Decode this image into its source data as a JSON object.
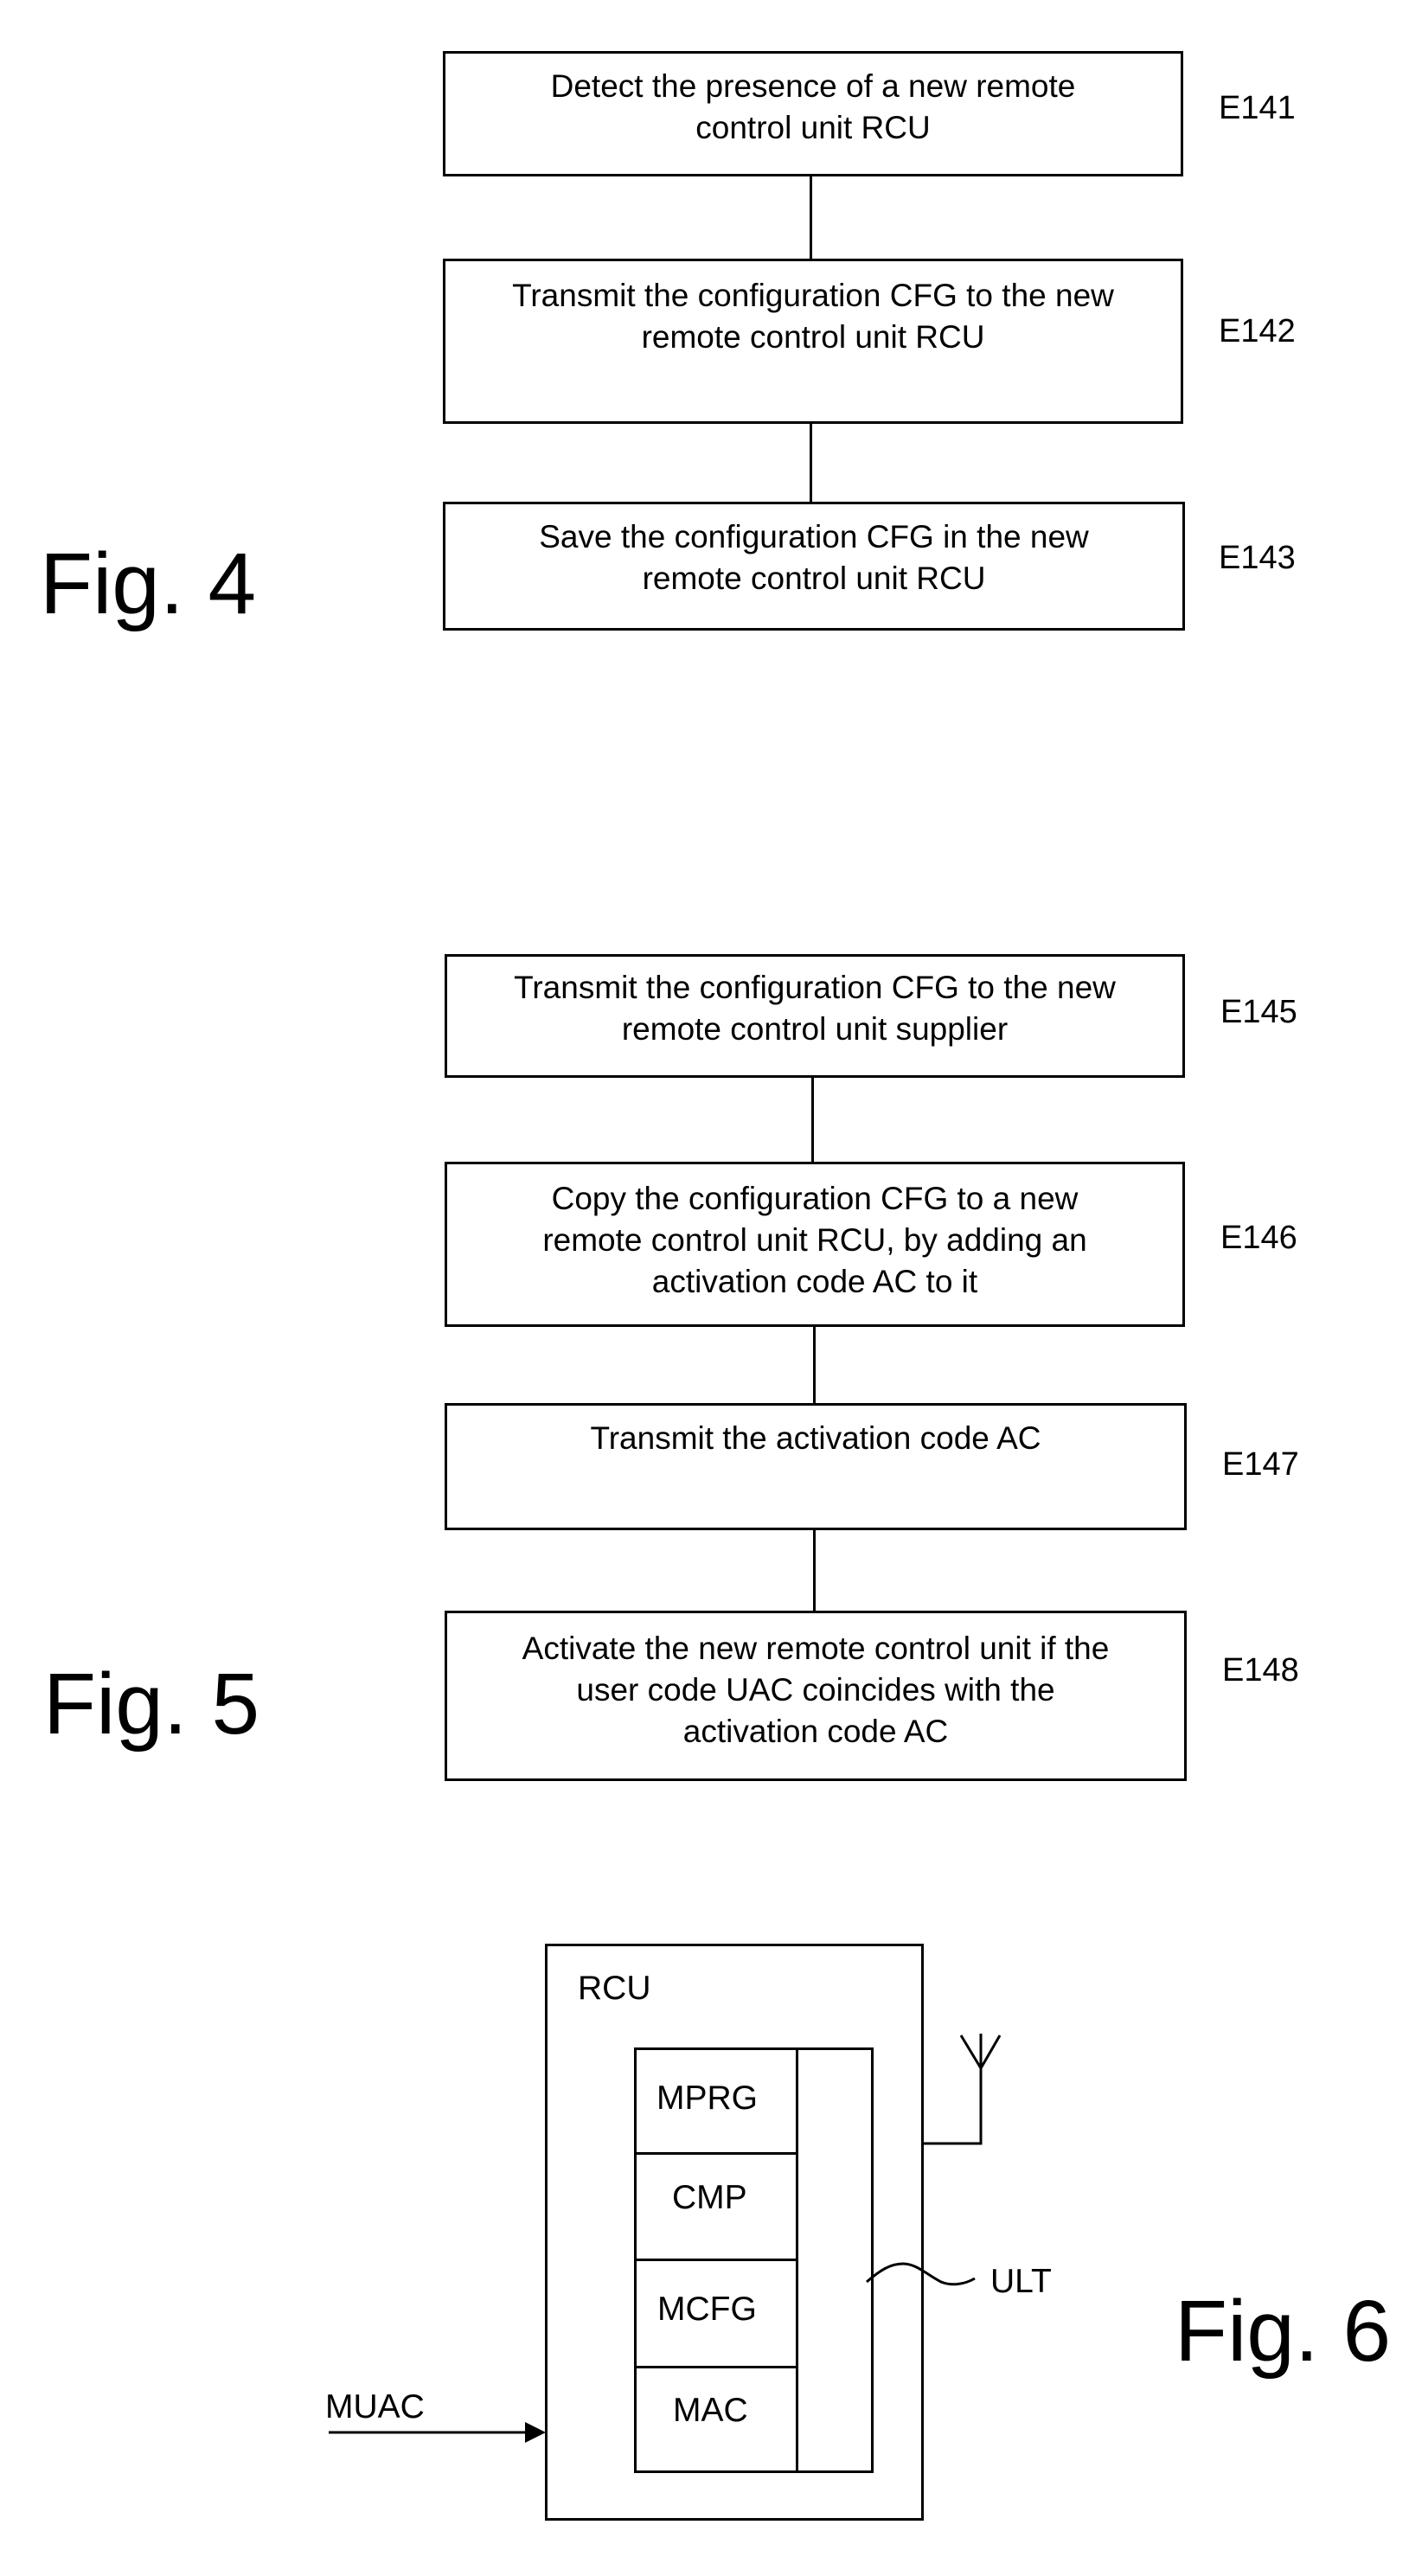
{
  "colors": {
    "ink": "#000000",
    "paper": "#ffffff"
  },
  "fig4": {
    "label": "Fig. 4",
    "steps": [
      {
        "id": "E141",
        "text": "Detect the presence of a new remote\ncontrol unit RCU"
      },
      {
        "id": "E142",
        "text": "Transmit the configuration CFG to the new\nremote control unit RCU"
      },
      {
        "id": "E143",
        "text": "Save the configuration CFG in the new\nremote control unit RCU"
      }
    ]
  },
  "fig5": {
    "label": "Fig. 5",
    "steps": [
      {
        "id": "E145",
        "text": "Transmit the configuration CFG to the new\nremote control unit supplier"
      },
      {
        "id": "E146",
        "text": "Copy the configuration CFG to a new\nremote control unit RCU, by adding an\nactivation code AC to it"
      },
      {
        "id": "E147",
        "text": "Transmit the activation code AC"
      },
      {
        "id": "E148",
        "text": "Activate the new remote control unit if the\nuser code UAC coincides with the\nactivation code AC"
      }
    ]
  },
  "fig6": {
    "label": "Fig. 6",
    "device_label": "RCU",
    "modules": [
      "MPRG",
      "CMP",
      "MCFG",
      "MAC"
    ],
    "link_label": "ULT",
    "input_label": "MUAC",
    "icons": {
      "antenna": "antenna-icon",
      "input_arrow": "arrow-right-icon"
    }
  }
}
